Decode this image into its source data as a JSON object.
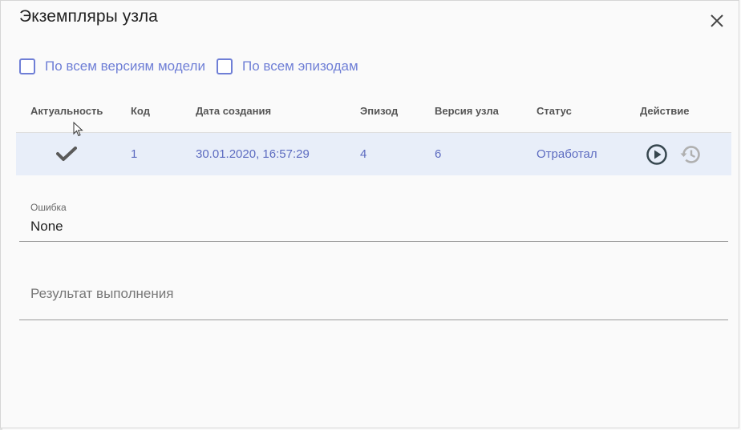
{
  "dialog": {
    "title": "Экземпляры узла",
    "close_icon": "close-icon"
  },
  "filters": [
    {
      "label": "По всем версиям модели",
      "checked": false
    },
    {
      "label": "По всем эпизодам",
      "checked": false
    }
  ],
  "table": {
    "columns": [
      "Актуальность",
      "Код",
      "Дата создания",
      "Эпизод",
      "Версия узла",
      "Статус",
      "Действие"
    ],
    "rows": [
      {
        "actual_icon": "check-icon",
        "code": "1",
        "created": "30.01.2020, 16:57:29",
        "episode": "4",
        "node_version": "6",
        "status": "Отработал",
        "actions": [
          "play-icon",
          "history-icon"
        ]
      }
    ]
  },
  "error_field": {
    "label": "Ошибка",
    "value": "None"
  },
  "result_field": {
    "placeholder": "Результат выполнения"
  },
  "colors": {
    "accent": "#6f7fd6",
    "row_highlight": "#e8eef9",
    "text_link": "#5c6bc0"
  }
}
